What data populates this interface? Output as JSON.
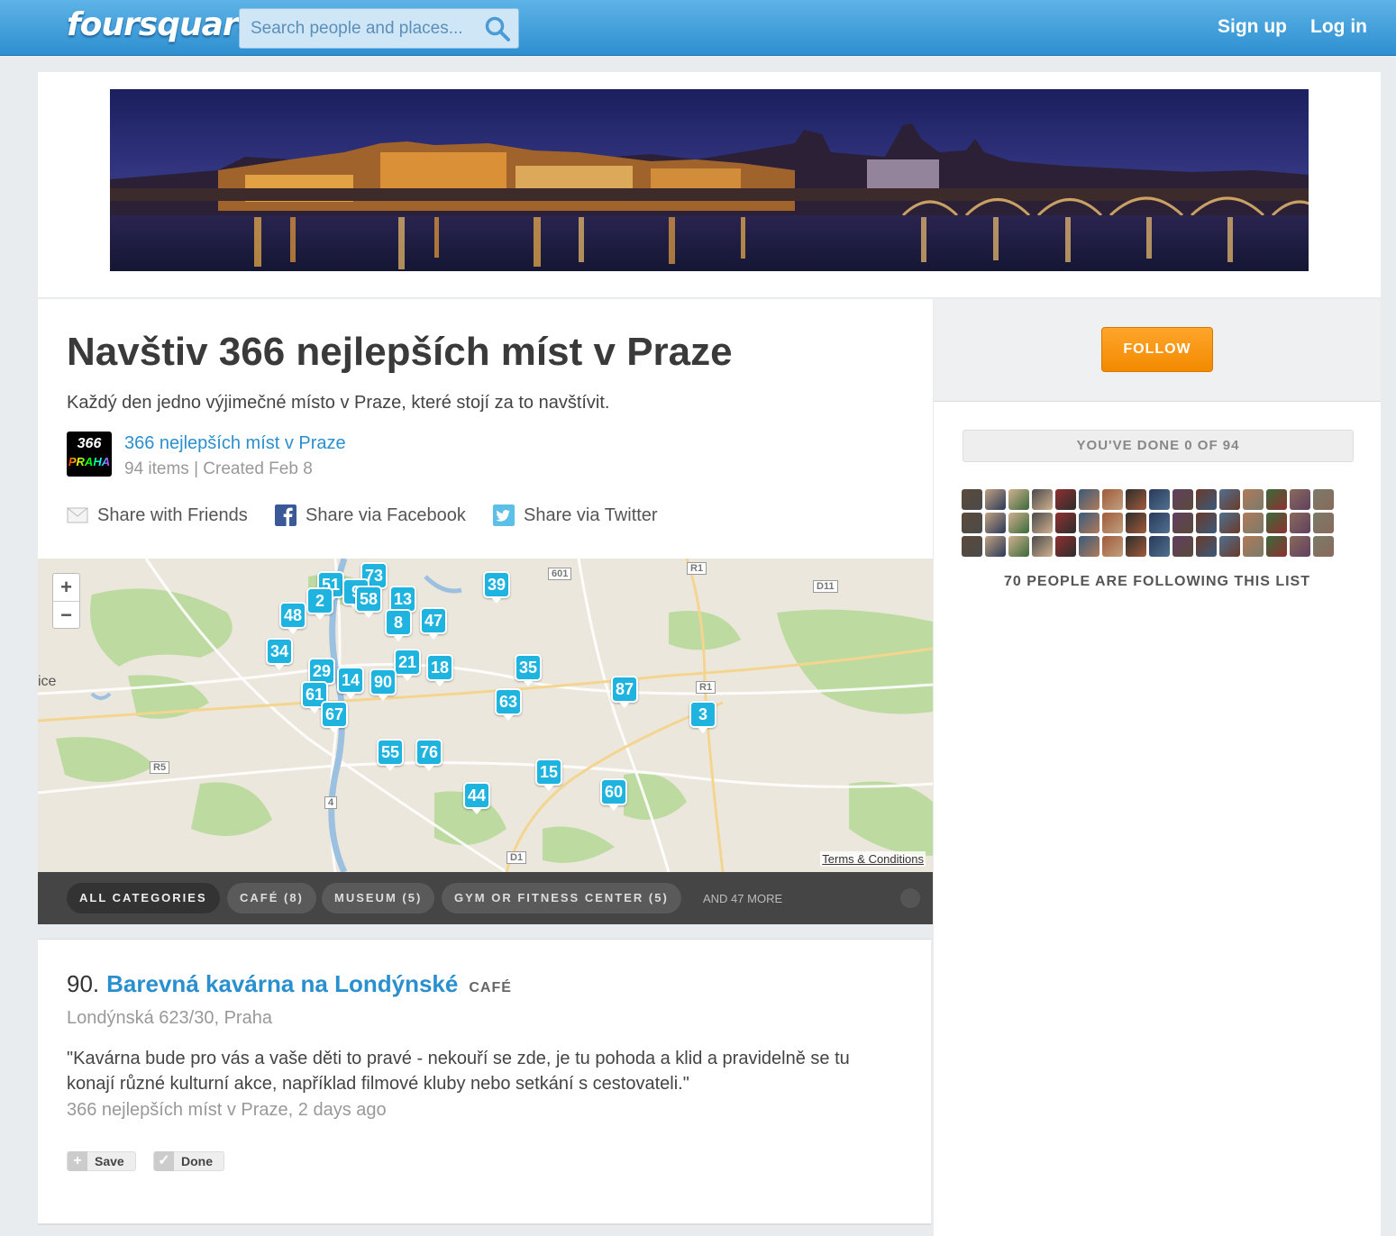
{
  "header": {
    "logo_text": "foursquare",
    "search_placeholder": "Search people and places...",
    "signup_label": "Sign up",
    "login_label": "Log in"
  },
  "list": {
    "title": "Navštiv 366 nejlepších míst v Praze",
    "description": "Každý den jedno výjimečné místo v Praze, které stojí za to navštívit.",
    "logo_line1": "366",
    "logo_line2": "PRAHA",
    "owner_name": "366 nejlepších míst v Praze",
    "meta": "94 items | Created Feb 8"
  },
  "share": {
    "friends": "Share with Friends",
    "facebook": "Share via Facebook",
    "twitter": "Share via Twitter"
  },
  "map": {
    "zoom_in": "+",
    "zoom_out": "−",
    "edge_label": "ice",
    "terms": "Terms & Conditions",
    "road_labels": [
      "601",
      "R1",
      "D11",
      "R1",
      "R5",
      "4",
      "D1"
    ],
    "pins": [
      "73",
      "51",
      "9",
      "58",
      "13",
      "2",
      "48",
      "8",
      "47",
      "39",
      "34",
      "21",
      "18",
      "35",
      "29",
      "14",
      "90",
      "61",
      "67",
      "87",
      "63",
      "3",
      "55",
      "76",
      "15",
      "44",
      "60"
    ]
  },
  "categories": {
    "items": [
      "ALL CATEGORIES",
      "CAFÉ (8)",
      "MUSEUM (5)",
      "GYM OR FITNESS CENTER (5)"
    ],
    "more": "AND 47 MORE"
  },
  "sidebar": {
    "follow_label": "FOLLOW",
    "progress": "YOU'VE DONE 0 OF 94",
    "done_count": 0,
    "total_count": 94,
    "followers_text": "70 PEOPLE ARE FOLLOWING THIS LIST",
    "avatar_count": 48
  },
  "item": {
    "number": "90.",
    "name": "Barevná kavárna na Londýnské",
    "category": "CAFÉ",
    "address": "Londýnská 623/30, Praha",
    "quote": "\"Kavárna bude pro vás a vaše děti to pravé - nekouří se zde, je tu pohoda a klid a pravidelně se tu konají různé kulturní akce, například filmové kluby nebo setkání s cestovateli.\"",
    "source": "366 nejlepších míst v Praze, 2 days ago",
    "save_label": "Save",
    "done_label": "Done"
  },
  "colors": {
    "header_blue": "#3a9ddb",
    "link_blue": "#2a8fcf",
    "pin_blue": "#1fb3e0",
    "follow_orange": "#f7941d"
  }
}
